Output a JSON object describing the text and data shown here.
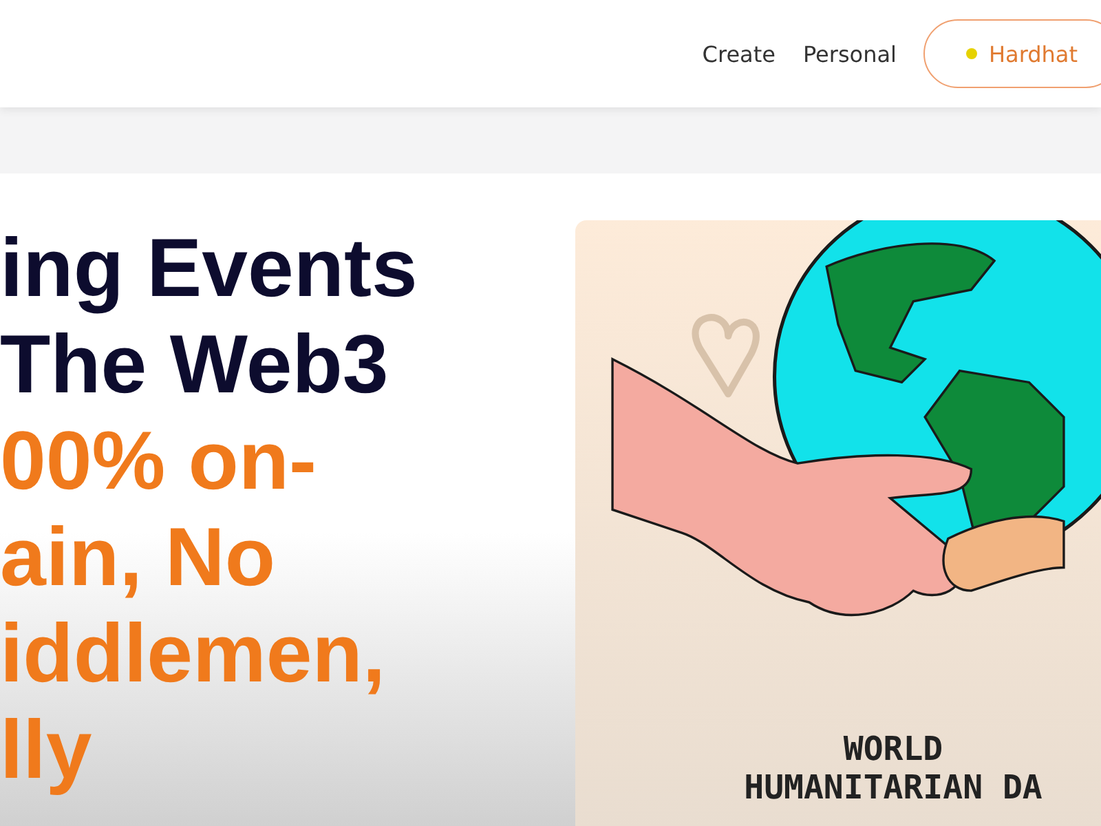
{
  "nav": {
    "links": [
      "Create",
      "Personal"
    ],
    "network_button": {
      "label": "Hardhat",
      "connected": true
    }
  },
  "hero": {
    "headline_dark": [
      "ing Events",
      "The Web3"
    ],
    "headline_accent": [
      "00% on-",
      "ain, No",
      "iddlemen,",
      "lly"
    ]
  },
  "illustration": {
    "caption": [
      "WORLD",
      "HUMANITARIAN DA"
    ]
  }
}
